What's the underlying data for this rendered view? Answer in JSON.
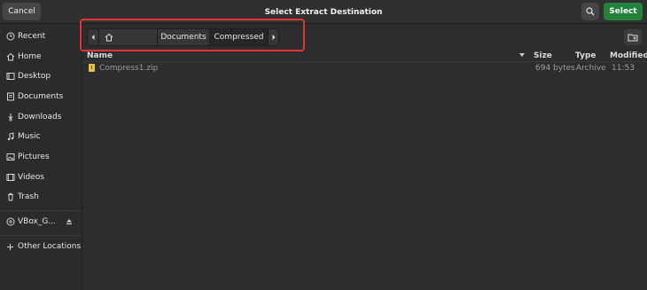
{
  "header": {
    "cancel_label": "Cancel",
    "title": "Select Extract Destination",
    "search_icon": "search-icon",
    "select_label": "Select"
  },
  "sidebar": {
    "items": [
      {
        "label": "Recent",
        "icon": "clock-icon"
      },
      {
        "label": "Home",
        "icon": "home-icon"
      },
      {
        "label": "Desktop",
        "icon": "desktop-icon"
      },
      {
        "label": "Documents",
        "icon": "document-icon"
      },
      {
        "label": "Downloads",
        "icon": "download-icon"
      },
      {
        "label": "Music",
        "icon": "music-icon"
      },
      {
        "label": "Pictures",
        "icon": "picture-icon"
      },
      {
        "label": "Videos",
        "icon": "video-icon"
      },
      {
        "label": "Trash",
        "icon": "trash-icon"
      }
    ],
    "device": {
      "label": "VBox_G...",
      "icon": "disc-icon",
      "eject_icon": "eject-icon"
    },
    "other": {
      "label": "Other Locations",
      "icon": "plus-icon"
    }
  },
  "pathbar": {
    "segments": [
      "Documents",
      "Compressed"
    ],
    "home_icon": "home-icon"
  },
  "columns": {
    "name": "Name",
    "size": "Size",
    "type": "Type",
    "modified": "Modified"
  },
  "files": [
    {
      "name": "Compress1.zip",
      "size": "694 bytes",
      "type": "Archive",
      "modified": "11:53",
      "icon": "zip-file-icon"
    }
  ],
  "colors": {
    "select_button": "#23823a",
    "highlight_box": "#e23434",
    "zip_icon": "#e7c33c"
  }
}
